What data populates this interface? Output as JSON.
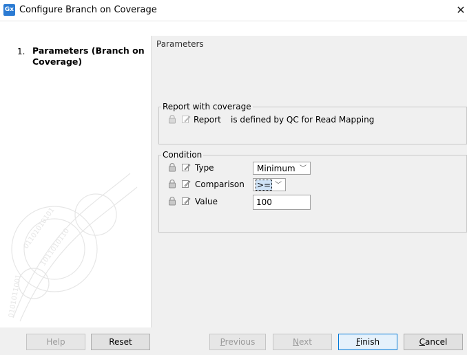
{
  "window": {
    "icon_text": "Gx",
    "title": "Configure Branch on Coverage",
    "close_glyph": "✕"
  },
  "steps": [
    {
      "number": "1.",
      "label": "Parameters (Branch on Coverage)"
    }
  ],
  "main": {
    "title": "Parameters",
    "report_group": {
      "legend": "Report with coverage",
      "row": {
        "label": "Report",
        "value": "is defined by QC for Read Mapping"
      }
    },
    "condition_group": {
      "legend": "Condition",
      "type": {
        "label": "Type",
        "value": "Minimum"
      },
      "comparison": {
        "label": "Comparison",
        "value": ">="
      },
      "value": {
        "label": "Value",
        "value": "100"
      }
    }
  },
  "buttons": {
    "help": "Help",
    "reset": "Reset",
    "previous": {
      "mnemonic": "P",
      "rest": "revious"
    },
    "next": {
      "mnemonic": "N",
      "rest": "ext"
    },
    "finish": {
      "mnemonic": "F",
      "rest": "inish"
    },
    "cancel": {
      "mnemonic": "C",
      "rest": "ancel"
    }
  },
  "icons": {
    "app": "gx-app-icon",
    "lock": "lock-icon",
    "edit": "edit-pencil-icon",
    "close": "close-icon",
    "dropdown": "chevron-down-icon"
  },
  "colors": {
    "accent": "#0078d7",
    "app_icon": "#2b7bd3",
    "panel_bg": "#f0f0f0"
  }
}
